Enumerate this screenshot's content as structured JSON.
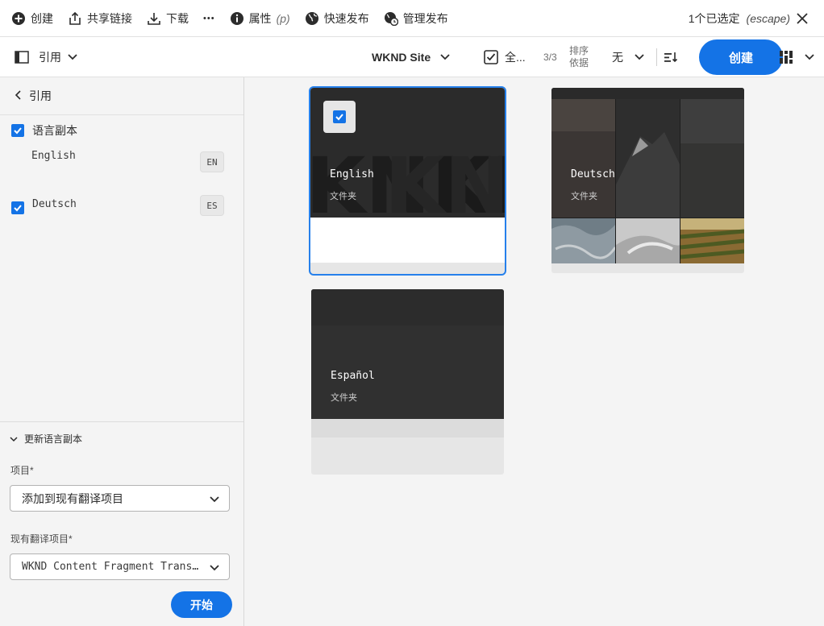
{
  "topbar": {
    "create": "创建",
    "share": "共享链接",
    "download": "下载",
    "more": "•••",
    "properties": "属性",
    "properties_shortcut": "(p)",
    "quick_publish": "快速发布",
    "manage_publish": "管理发布",
    "selection_count": "1个已选定",
    "selection_escape": "(escape)"
  },
  "toolbar": {
    "rail_label": "引用",
    "site": "WKND Site",
    "select_all": "全...",
    "count": "3/3",
    "sort_label_1": "排序",
    "sort_label_2": "依据",
    "sort_value": "无",
    "create_button": "创建"
  },
  "rail": {
    "back_label": "引用",
    "language_copy": "语言副本",
    "languages": [
      {
        "name": "English",
        "code": "EN"
      },
      {
        "name": "Deutsch",
        "code": "ES"
      }
    ],
    "update_section": "更新语言副本",
    "project_label": "项目*",
    "project_value": "添加到现有翻译项目",
    "existing_label": "现有翻译项目*",
    "existing_value": "WKND Content Fragment Trans…",
    "start_button": "开始"
  },
  "cards": [
    {
      "title": "English",
      "type": "文件夹"
    },
    {
      "title": "Deutsch",
      "type": "文件夹"
    },
    {
      "title": "Español",
      "type": "文件夹"
    }
  ],
  "colors": {
    "accent": "#1473e6",
    "selection_outline": "#2680eb"
  }
}
